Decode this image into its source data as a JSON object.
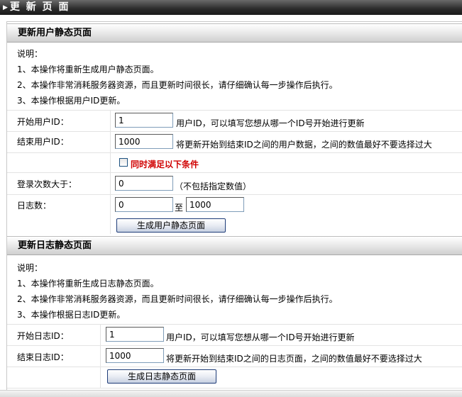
{
  "page": {
    "title": "更 新 页 面"
  },
  "user_section": {
    "header": "更新用户静态页面",
    "notes": [
      "说明：",
      "1、本操作将重新生成用户静态页面。",
      "2、本操作非常消耗服务器资源，而且更新时间很长，请仔细确认每一步操作后执行。",
      "3、本操作根据用户ID更新。"
    ],
    "start_label": "开始用户ID：",
    "start_value": "1",
    "start_hint": "用户ID，可以填写您想从哪一个ID号开始进行更新",
    "end_label": "结束用户ID：",
    "end_value": "1000",
    "end_hint": "将更新开始到结束ID之间的用户数据，之间的数值最好不要选择过大",
    "condition_label": "同时满足以下条件",
    "condition_checked": false,
    "login_label": "登录次数大于：",
    "login_value": "0",
    "login_hint": "（不包括指定数值）",
    "log_label": "日志数：",
    "log_min": "0",
    "log_to": "至",
    "log_max": "1000",
    "button": "生成用户静态页面"
  },
  "log_section": {
    "header": "更新日志静态页面",
    "notes": [
      "说明：",
      "1、本操作将重新生成日志静态页面。",
      "2、本操作非常消耗服务器资源，而且更新时间很长，请仔细确认每一步操作后执行。",
      "3、本操作根据日志ID更新。"
    ],
    "start_label": "开始日志ID：",
    "start_value": "1",
    "start_hint": "用户ID，可以填写您想从哪一个ID号开始进行更新",
    "end_label": "结束日志ID：",
    "end_value": "1000",
    "end_hint": "将更新开始到结束ID之间的日志页面，之间的数值最好不要选择过大",
    "button": "生成日志静态页面"
  }
}
